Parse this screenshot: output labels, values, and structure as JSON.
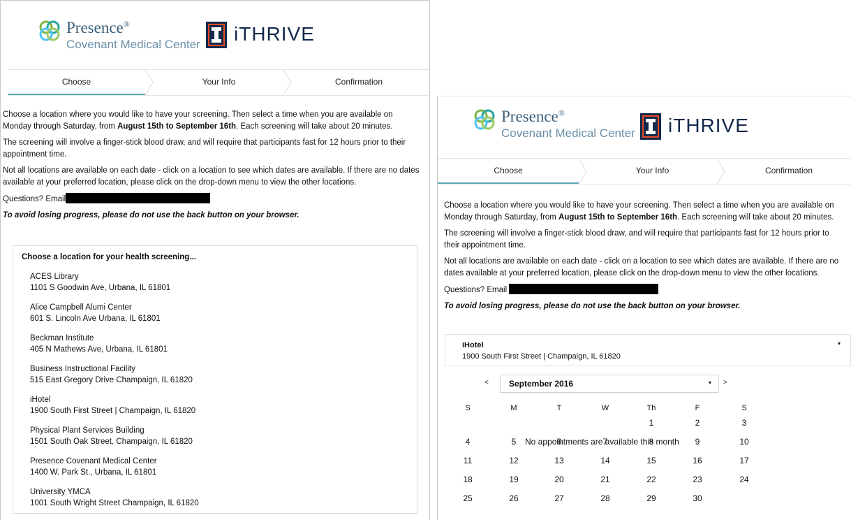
{
  "brand": {
    "presence_name": "Presence",
    "presence_reg": "®",
    "presence_sub": "Covenant Medical Center",
    "ithrive": "iTHRIVE"
  },
  "steps": [
    "Choose",
    "Your Info",
    "Confirmation"
  ],
  "intro": {
    "p1_a": "Choose a location where you would like to have your screening. Then select a time when you are available on Monday through Saturday, from ",
    "p1_bold": "August 15th to September 16th",
    "p1_b": ". Each screening will take about 20 minutes.",
    "p2": "The screening will involve a finger-stick blood draw, and will require that participants fast for 12 hours prior to their appointment time.",
    "p3": "Not all locations are available on each date - click on a location to see which dates are available. If there are no dates available at your preferred location, please click on the drop-down menu to view the other locations.",
    "questions": "Questions? Email",
    "warning": "To avoid losing progress, please do not use the back button on your browser."
  },
  "locations_title": "Choose a location for your health screening...",
  "locations": [
    {
      "name": "ACES Library",
      "address": "1101 S Goodwin Ave, Urbana, IL 61801"
    },
    {
      "name": "Alice Campbell Alumi Center",
      "address": "601 S. Lincoln Ave Urbana, IL 61801"
    },
    {
      "name": "Beckman Institute",
      "address": "405 N Mathews Ave, Urbana, IL 61801"
    },
    {
      "name": "Business Instructional Facility",
      "address": "515 East Gregory Drive Champaign, IL 61820"
    },
    {
      "name": "iHotel",
      "address": "1900 South First Street | Champaign, IL 61820"
    },
    {
      "name": "Physical Plant Services Building",
      "address": "1501 South Oak Street, Champaign, IL 61820"
    },
    {
      "name": "Presence Covenant Medical Center",
      "address": "1400 W. Park St., Urbana, IL 61801"
    },
    {
      "name": "University YMCA",
      "address": "1001 South Wright Street Champaign, IL 61820"
    }
  ],
  "selected_location": {
    "name": "iHotel",
    "address": "1900 South First Street | Champaign, IL 61820",
    "caret": "▾"
  },
  "calendar": {
    "prev": "<",
    "next": ">",
    "month": "September 2016",
    "month_caret": "▾",
    "weekdays": [
      "S",
      "M",
      "T",
      "W",
      "Th",
      "F",
      "S"
    ],
    "weeks": [
      [
        "",
        "",
        "",
        "",
        "1",
        "2",
        "3"
      ],
      [
        "4",
        "5",
        "6",
        "7",
        "8",
        "9",
        "10"
      ],
      [
        "11",
        "12",
        "13",
        "14",
        "15",
        "16",
        "17"
      ],
      [
        "18",
        "19",
        "20",
        "21",
        "22",
        "23",
        "24"
      ],
      [
        "25",
        "26",
        "27",
        "28",
        "29",
        "30",
        ""
      ]
    ],
    "no_appointments": "No appointments are available this month"
  },
  "colors": {
    "accent": "#5ba8b4",
    "brand_blue": "#3a5f7a",
    "illinois_navy": "#13294b",
    "illinois_orange": "#e84a27"
  }
}
